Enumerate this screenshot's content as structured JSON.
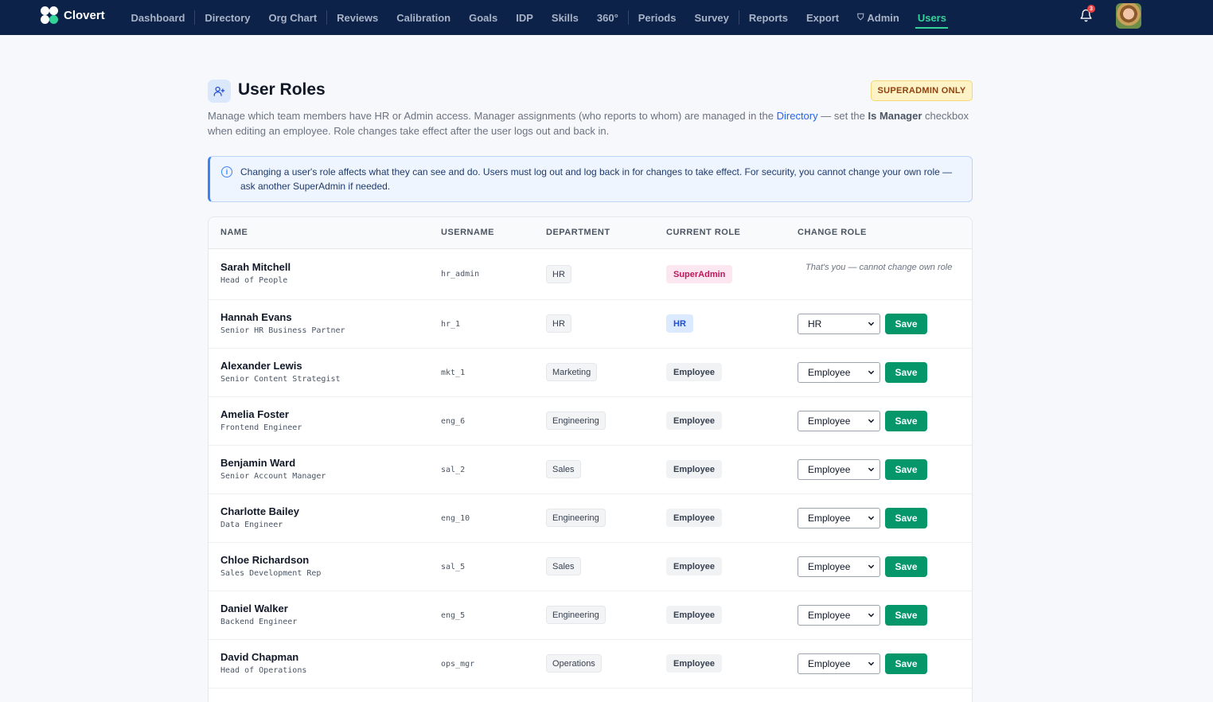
{
  "app": {
    "brand": "Clovert",
    "nav": [
      {
        "label": "Dashboard"
      },
      {
        "label": "Directory"
      },
      {
        "label": "Org Chart"
      },
      {
        "label": "Reviews"
      },
      {
        "label": "Calibration"
      },
      {
        "label": "Goals"
      },
      {
        "label": "IDP"
      },
      {
        "label": "Skills"
      },
      {
        "label": "360°"
      },
      {
        "label": "Periods"
      },
      {
        "label": "Survey"
      },
      {
        "label": "Reports"
      },
      {
        "label": "Export"
      },
      {
        "label": "Admin",
        "icon": "shield-icon"
      },
      {
        "label": "Users",
        "active": true
      }
    ],
    "notification_count": "3"
  },
  "page": {
    "title": "User Roles",
    "badge": "SUPERADMIN ONLY",
    "desc_part1": "Manage which team members have HR or Admin access. Manager assignments (who reports to whom) are managed in the ",
    "desc_link": "Directory",
    "desc_part2": " — set the ",
    "desc_bold": "Is Manager",
    "desc_part3": " checkbox when editing an employee. Role changes take effect after the user logs out and back in.",
    "info": "Changing a user's role affects what they can see and do. Users must log out and log back in for changes to take effect. For security, you cannot change your own role — ask another SuperAdmin if needed."
  },
  "table": {
    "headers": {
      "name": "NAME",
      "username": "USERNAME",
      "department": "DEPARTMENT",
      "current_role": "CURRENT ROLE",
      "change_role": "CHANGE ROLE"
    },
    "save_label": "Save",
    "self_note": "That's you — cannot change own role",
    "rows": [
      {
        "name": "Sarah Mitchell",
        "title": "Head of People",
        "username": "hr_admin",
        "department": "HR",
        "role": "SuperAdmin",
        "select": "",
        "self": true
      },
      {
        "name": "Hannah Evans",
        "title": "Senior HR Business Partner",
        "username": "hr_1",
        "department": "HR",
        "role": "HR",
        "select": "HR"
      },
      {
        "name": "Alexander Lewis",
        "title": "Senior Content Strategist",
        "username": "mkt_1",
        "department": "Marketing",
        "role": "Employee",
        "select": "Employee"
      },
      {
        "name": "Amelia Foster",
        "title": "Frontend Engineer",
        "username": "eng_6",
        "department": "Engineering",
        "role": "Employee",
        "select": "Employee"
      },
      {
        "name": "Benjamin Ward",
        "title": "Senior Account Manager",
        "username": "sal_2",
        "department": "Sales",
        "role": "Employee",
        "select": "Employee"
      },
      {
        "name": "Charlotte Bailey",
        "title": "Data Engineer",
        "username": "eng_10",
        "department": "Engineering",
        "role": "Employee",
        "select": "Employee"
      },
      {
        "name": "Chloe Richardson",
        "title": "Sales Development Rep",
        "username": "sal_5",
        "department": "Sales",
        "role": "Employee",
        "select": "Employee"
      },
      {
        "name": "Daniel Walker",
        "title": "Backend Engineer",
        "username": "eng_5",
        "department": "Engineering",
        "role": "Employee",
        "select": "Employee"
      },
      {
        "name": "David Chapman",
        "title": "Head of Operations",
        "username": "ops_mgr",
        "department": "Operations",
        "role": "Employee",
        "select": "Employee"
      }
    ]
  }
}
